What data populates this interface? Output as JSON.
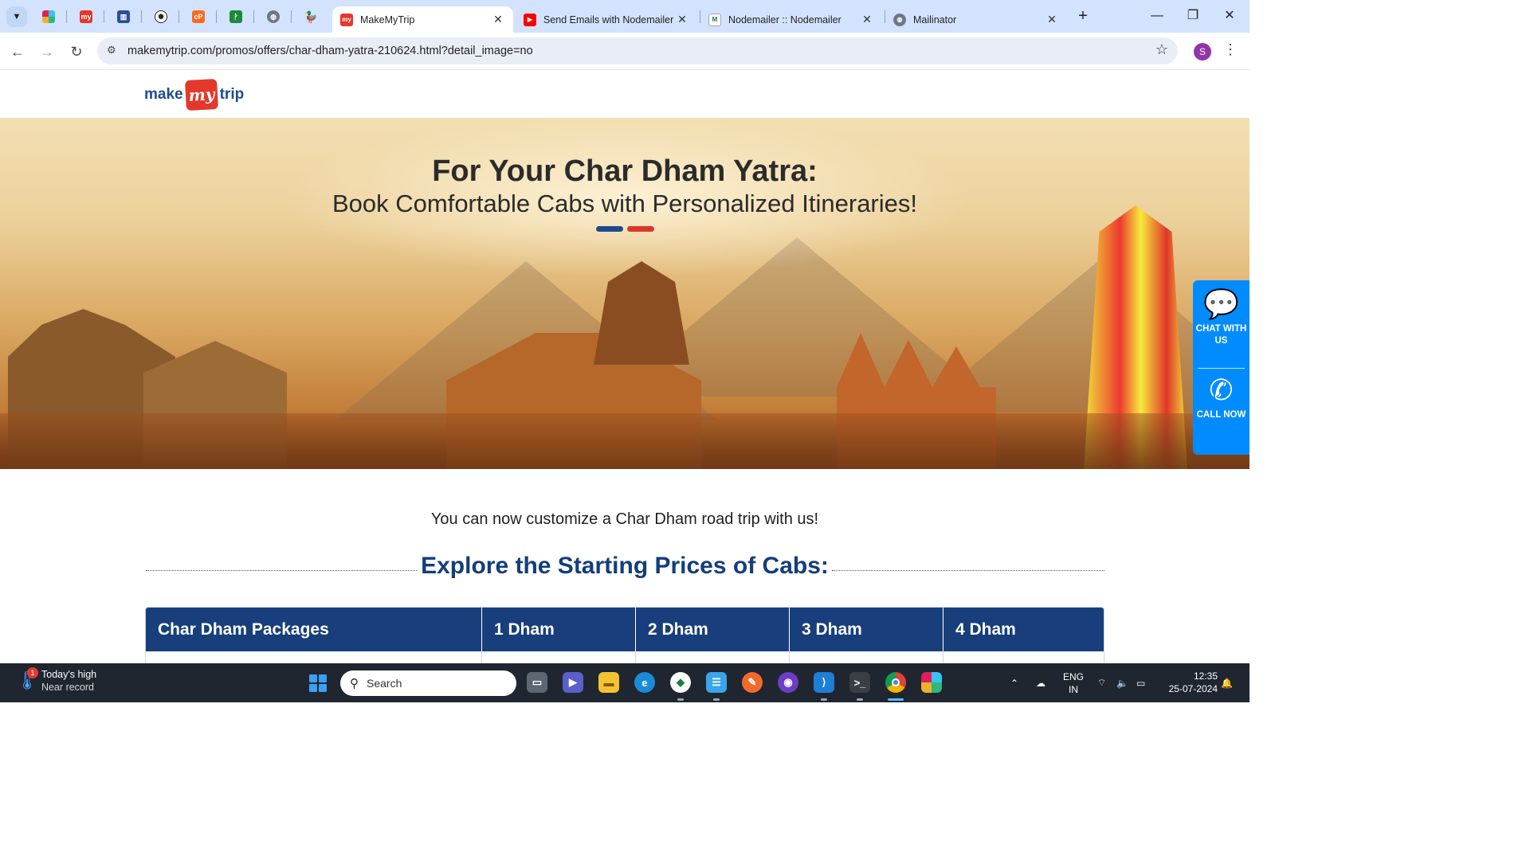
{
  "browser": {
    "tabs": [
      {
        "title": "MakeMyTrip",
        "active": true
      },
      {
        "title": "Send Emails with Nodemailer",
        "active": false
      },
      {
        "title": "Nodemailer :: Nodemailer",
        "active": false
      },
      {
        "title": "Mailinator",
        "active": false
      }
    ],
    "new_tab_symbol": "+",
    "window_controls": {
      "minimize": "—",
      "restore": "❐",
      "close": "✕"
    },
    "url": "makemytrip.com/promos/offers/char-dham-yatra-210624.html?detail_image=no",
    "profile_initial": "S"
  },
  "site": {
    "logo": {
      "make": "make",
      "my": "my",
      "trip": "trip"
    },
    "hero": {
      "title": "For Your Char Dham Yatra:",
      "subtitle": "Book Comfortable Cabs with Personalized Itineraries!",
      "accent_colors": [
        "#1a4c8d",
        "#d9372b"
      ]
    },
    "float_panel": {
      "chat": "CHAT WITH US",
      "call": "CALL NOW"
    },
    "intro": "You can now customize a Char Dham road trip with us!",
    "section_title": "Explore the Starting Prices of Cabs:",
    "table": {
      "headers": [
        "Char Dham Packages",
        "1 Dham",
        "2 Dham",
        "3 Dham",
        "4 Dham"
      ]
    }
  },
  "taskbar": {
    "weather": {
      "line1": "Today's high",
      "line2": "Near record",
      "badge": "1"
    },
    "search_placeholder": "Search",
    "language": {
      "line1": "ENG",
      "line2": "IN"
    },
    "time": "12:35",
    "date": "25-07-2024"
  }
}
